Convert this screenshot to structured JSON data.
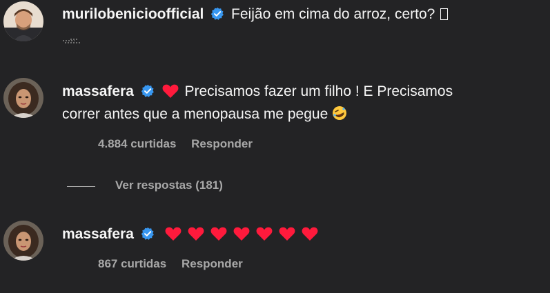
{
  "comments": [
    {
      "username": "murilobenicioofficial",
      "verified": true,
      "text": "Feijão em cima do arroz, certo?",
      "trailing_glyph": "missing-glyph",
      "avatar": "avatar-man-icon"
    },
    {
      "username": "massafera",
      "verified": true,
      "text_line1": "Precisamos fazer um filho ! E Precisamos",
      "text_line2": "correr antes que a menopausa me pegue",
      "emoji_prefix": "red-heart-icon",
      "emoji_suffix": "rolling-laughing-icon",
      "likes": "4.884 curtidas",
      "reply_label": "Responder",
      "view_replies": "Ver respostas (181)"
    },
    {
      "username": "massafera",
      "verified": true,
      "hearts": 7,
      "likes": "867 curtidas",
      "reply_label": "Responder"
    }
  ],
  "colors": {
    "background": "#232325",
    "text": "#f5f5f5",
    "muted": "#a8a8a8",
    "verified_blue": "#3897f0",
    "heart_red": "#ff1a3c"
  }
}
